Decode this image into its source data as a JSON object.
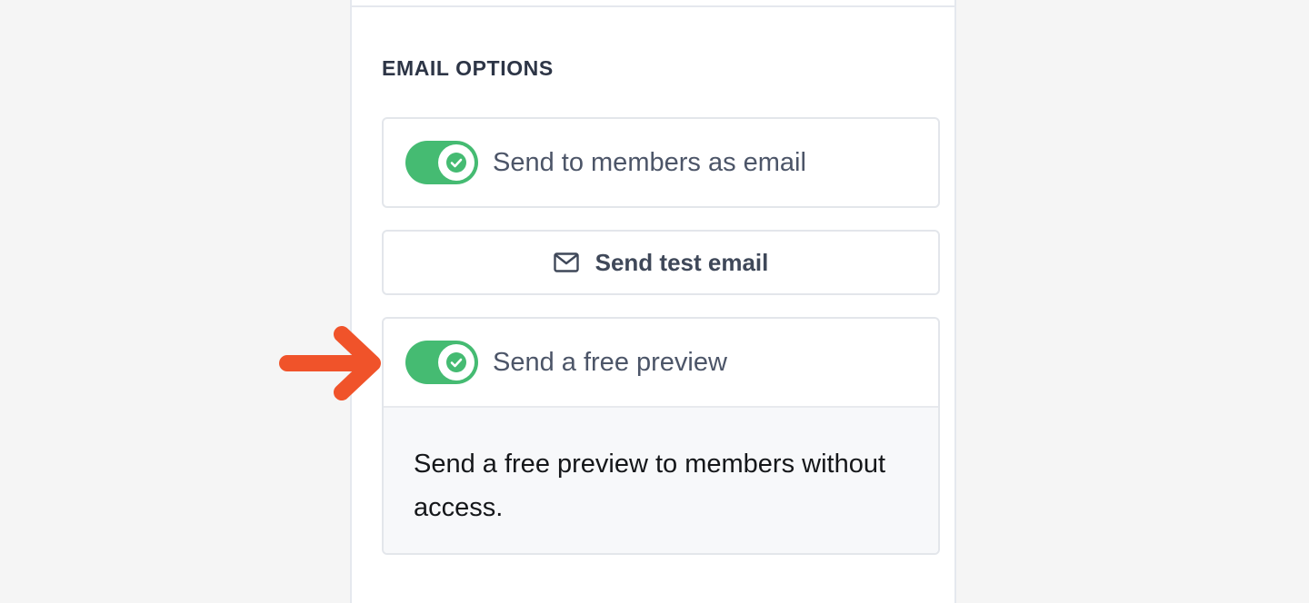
{
  "email_options": {
    "title": "EMAIL OPTIONS",
    "send_to_members": {
      "label": "Send to members as email",
      "enabled": true
    },
    "send_test": {
      "label": "Send test email",
      "icon": "mail-icon"
    },
    "free_preview": {
      "label": "Send a free preview",
      "enabled": true,
      "description": "Send a free preview to members without access."
    }
  },
  "colors": {
    "toggle_on": "#45bb72",
    "annotation_arrow": "#f0532a",
    "text_primary": "#4c5568"
  }
}
